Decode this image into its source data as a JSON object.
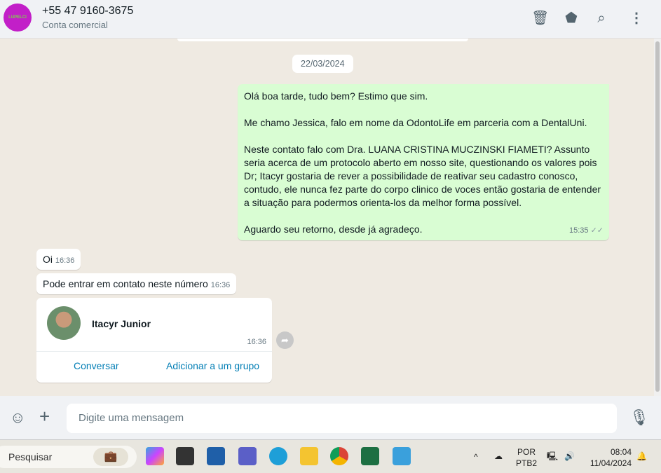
{
  "header": {
    "contact": "+55 47 9160-3675",
    "subtitle": "Conta comercial",
    "logo_text": "LUPELCI"
  },
  "chat": {
    "date": "22/03/2024",
    "outgoing": {
      "text": "Olá boa tarde, tudo bem? Estimo que sim.\n\nMe chamo Jessica, falo em nome da OdontoLife em parceria com a DentalUni.\n\nNeste contato falo com Dra. LUANA CRISTINA MUCZINSKI FIAMETI? Assunto seria acerca de um protocolo aberto em nosso site, questionando os valores pois Dr; Itacyr gostaria de rever a possibilidade de reativar seu cadastro conosco, contudo, ele nunca fez parte do corpo clinico de voces então gostaria de entender a situação para podermos orienta-los da melhor forma possível.\n\nAguardo seu retorno, desde já agradeço.",
      "time": "15:35"
    },
    "incoming": [
      {
        "text": "Oi",
        "time": "16:36"
      },
      {
        "text": "Pode entrar em contato neste número",
        "time": "16:36"
      }
    ],
    "contact_card": {
      "name": "Itacyr Junior",
      "time": "16:36",
      "action1": "Conversar",
      "action2": "Adicionar a um grupo"
    }
  },
  "composer": {
    "placeholder": "Digite uma mensagem"
  },
  "taskbar": {
    "search": "Pesquisar",
    "lang1": "POR",
    "lang2": "PTB2",
    "time": "08:04",
    "date": "11/04/2024"
  }
}
